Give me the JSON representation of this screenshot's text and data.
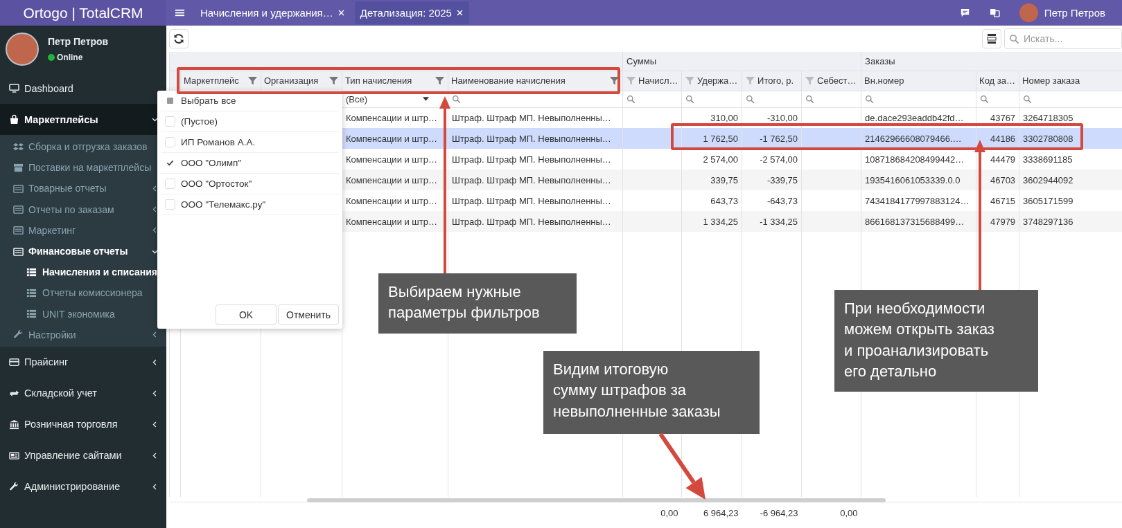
{
  "brand": "Ortogo | TotalCRM",
  "tabs": [
    {
      "label": "Начисления и удержания…",
      "selected": false
    },
    {
      "label": "Детализация: 2025",
      "selected": true
    }
  ],
  "account": {
    "name": "Петр Петров"
  },
  "user": {
    "name": "Петр Петров",
    "status_text": "Online",
    "online": true
  },
  "sidebar": {
    "items": [
      {
        "label": "Dashboard",
        "selected": false
      },
      {
        "label": "Маркетплейсы",
        "selected": true,
        "expanded": true,
        "children": [
          {
            "label": "Сборка и отгрузка заказов",
            "selected": false
          },
          {
            "label": "Поставки на маркетплейсы",
            "selected": false
          },
          {
            "label": "Товарные отчеты",
            "selected": false,
            "expanded": false
          },
          {
            "label": "Отчеты по заказам",
            "selected": false,
            "expanded": false
          },
          {
            "label": "Маркетинг",
            "selected": false,
            "expanded": false
          },
          {
            "label": "Финансовые отчеты",
            "selected": true,
            "expanded": true,
            "children": [
              {
                "label": "Начисления и списания",
                "selected": true
              },
              {
                "label": "Отчеты комиссионера",
                "selected": false
              },
              {
                "label": "UNIT экономика",
                "selected": false
              }
            ]
          },
          {
            "label": "Настройки",
            "selected": false,
            "expanded": false
          }
        ]
      },
      {
        "label": "Прайсинг",
        "selected": false,
        "expanded": false
      },
      {
        "label": "Складской учет",
        "selected": false,
        "expanded": false
      },
      {
        "label": "Розничная торговля",
        "selected": false,
        "expanded": false
      },
      {
        "label": "Управление сайтами",
        "selected": false,
        "expanded": false
      },
      {
        "label": "Администрирование",
        "selected": false,
        "expanded": false
      }
    ]
  },
  "toolbar": {
    "search": {
      "placeholder": "Искать..."
    }
  },
  "table": {
    "column_groups": [
      {
        "columns": [
          {
            "kind": "narrow"
          },
          {
            "kind": "lookup",
            "label": "Маркетплейс"
          },
          {
            "kind": "lookup",
            "label": "Организация"
          },
          {
            "kind": "lookup",
            "label": "Тип начисления",
            "filter": {
              "kind": "select",
              "value": "(Все)"
            }
          },
          {
            "kind": "lookup",
            "label": "Наименование начисления",
            "filter": {
              "kind": "search"
            }
          }
        ]
      },
      {
        "label": "Суммы",
        "columns": [
          {
            "kind": "sum",
            "label": "Начисл…",
            "filter": {
              "kind": "search"
            },
            "total": "0,00"
          },
          {
            "kind": "sum",
            "label": "Удержа…",
            "filter": {
              "kind": "search"
            },
            "total": "6 964,23"
          },
          {
            "kind": "sum",
            "label": "Итого, р.",
            "filter": {
              "kind": "search"
            },
            "total": "-6 964,23"
          },
          {
            "kind": "sum",
            "label": "Себест…",
            "filter": {
              "kind": "search"
            },
            "total": "0,00"
          }
        ]
      },
      {
        "label": "Заказы",
        "columns": [
          {
            "kind": "text",
            "label": "Вн.номер",
            "filter": {
              "kind": "search"
            }
          },
          {
            "kind": "id",
            "label": "Код за…",
            "filter": {
              "kind": "search"
            }
          },
          {
            "kind": "text",
            "label": "Номер заказа",
            "filter": {
              "kind": "search"
            }
          }
        ]
      }
    ],
    "rows": [
      {
        "selected": false,
        "cells": [
          null,
          null,
          null,
          "Компенсации и штр…",
          "Штраф. Штраф МП. Невыполненны…",
          null,
          "310,00",
          "-310,00",
          null,
          "de.dace293eaddb42fd…",
          "43767",
          "3264718305"
        ]
      },
      {
        "selected": true,
        "cells": [
          null,
          null,
          null,
          "Компенсации и штр…",
          "Штраф. Штраф МП. Невыполненны…",
          null,
          "1 762,50",
          "-1 762,50",
          null,
          "21462966608079466.…",
          "44186",
          "3302780808"
        ]
      },
      {
        "selected": false,
        "cells": [
          null,
          null,
          null,
          "Компенсации и штр…",
          "Штраф. Штраф МП. Невыполненны…",
          null,
          "2 574,00",
          "-2 574,00",
          null,
          "108718684208499442…",
          "44479",
          "3338691185"
        ]
      },
      {
        "selected": false,
        "cells": [
          null,
          null,
          null,
          "Компенсации и штр…",
          "Штраф. Штраф МП. Невыполненны…",
          null,
          "339,75",
          "-339,75",
          null,
          "1935416061053339.0.0",
          "46703",
          "3602944092"
        ]
      },
      {
        "selected": false,
        "cells": [
          null,
          null,
          null,
          "Компенсации и штр…",
          "Штраф. Штраф МП. Невыполненны…",
          null,
          "643,73",
          "-643,73",
          null,
          "7434184177997883124…",
          "46715",
          "3605171599"
        ]
      },
      {
        "selected": false,
        "cells": [
          null,
          null,
          null,
          "Компенсации и штр…",
          "Штраф. Штраф МП. Невыполненны…",
          null,
          "1 334,25",
          "-1 334,25",
          null,
          "866168137315688499…",
          "47979",
          "3748297136"
        ]
      }
    ]
  },
  "filter_popup": {
    "select_all": {
      "label": "Выбрать все",
      "indeterminate": true
    },
    "options": [
      {
        "label": "(Пустое)",
        "checked": false
      },
      {
        "label": "ИП Романов А.А.",
        "checked": false
      },
      {
        "label": "ООО \"Олимп\"",
        "checked": true
      },
      {
        "label": "ООО \"Ортосток\"",
        "checked": false
      },
      {
        "label": "ООО \"Телемакс.ру\"",
        "checked": false
      }
    ],
    "buttons": [
      "OK",
      "Отменить"
    ]
  },
  "callouts": [
    {
      "lines": [
        "Выбираем нужные",
        "параметры фильтров"
      ]
    },
    {
      "lines": [
        "Видим итоговую",
        "сумму штрафов за",
        "невыполненные заказы"
      ]
    },
    {
      "lines": [
        "При необходимости",
        "можем открыть заказ",
        "и проанализировать",
        "его детально"
      ]
    }
  ]
}
